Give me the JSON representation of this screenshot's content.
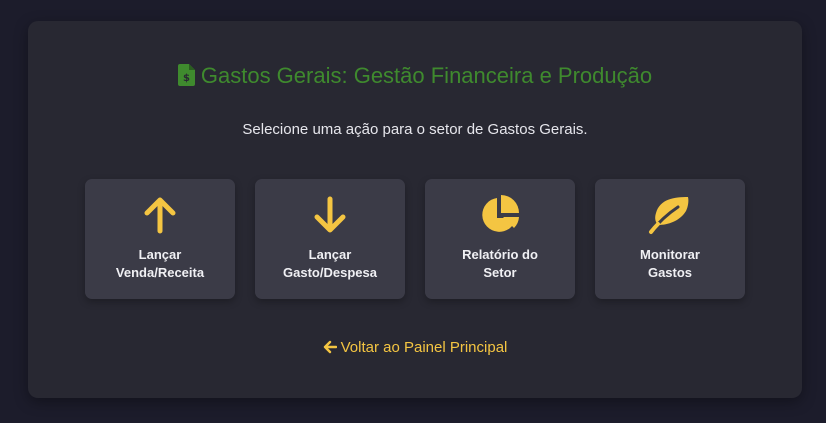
{
  "header": {
    "icon": "file-invoice-dollar-icon",
    "title": "Gastos Gerais: Gestão Financeira e Produção"
  },
  "subtitle": "Selecione uma ação para o setor de Gastos Gerais.",
  "actions": [
    {
      "icon": "arrow-up-icon",
      "label_line1": "Lançar",
      "label_line2": "Venda/Receita"
    },
    {
      "icon": "arrow-down-icon",
      "label_line1": "Lançar",
      "label_line2": "Gasto/Despesa"
    },
    {
      "icon": "pie-chart-icon",
      "label_line1": "Relatório do",
      "label_line2": "Setor"
    },
    {
      "icon": "leaf-icon",
      "label_line1": "Monitorar",
      "label_line2": "Gastos"
    }
  ],
  "back_link": {
    "icon": "arrow-left-icon",
    "label": "Voltar ao Painel Principal"
  },
  "colors": {
    "background": "#1c1c2b",
    "panel": "#282832",
    "card": "#3b3b47",
    "title_green": "#3f8a2e",
    "accent_yellow": "#f4c542",
    "text": "#e6e6ec"
  }
}
